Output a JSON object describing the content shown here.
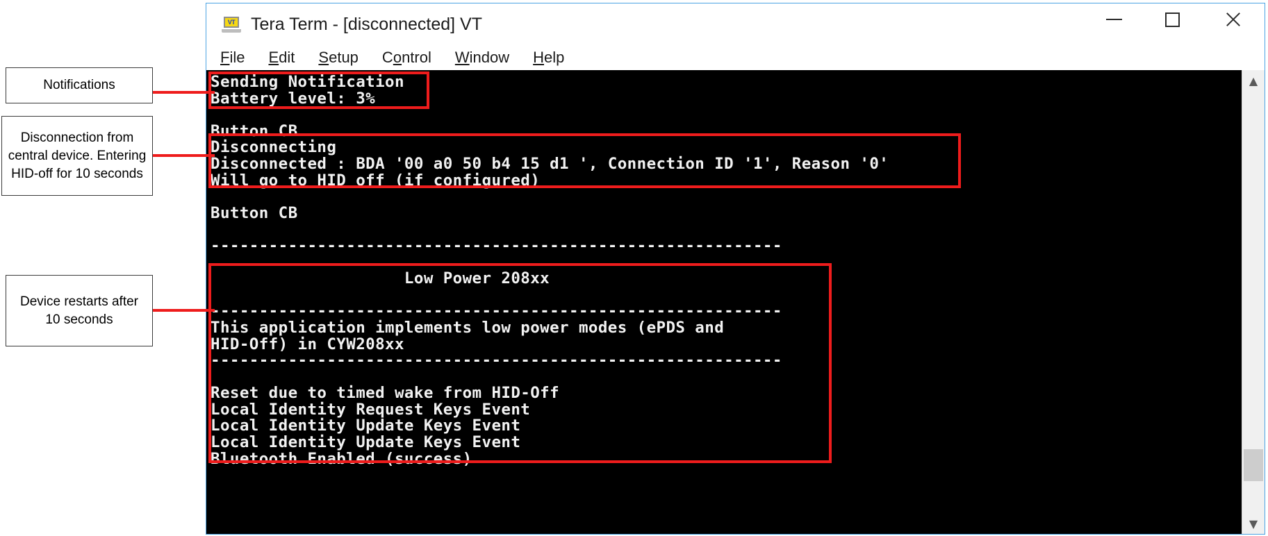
{
  "window": {
    "title": "Tera Term - [disconnected] VT",
    "icon": "teraterm-vt-icon",
    "icon_text": "VT",
    "controls": {
      "minimize": "minimize-icon",
      "maximize": "maximize-icon",
      "close": "close-icon"
    }
  },
  "menubar": {
    "items": [
      {
        "label": "File",
        "accel": "F"
      },
      {
        "label": "Edit",
        "accel": "E"
      },
      {
        "label": "Setup",
        "accel": "S"
      },
      {
        "label": "Control",
        "accel": "o"
      },
      {
        "label": "Window",
        "accel": "W"
      },
      {
        "label": "Help",
        "accel": "H"
      }
    ]
  },
  "terminal": {
    "lines": [
      "Sending Notification",
      "Battery level: 3%",
      "",
      "Button CB",
      "Disconnecting",
      "Disconnected : BDA '00 a0 50 b4 15 d1 ', Connection ID '1', Reason '0'",
      "Will go to HID off (if configured)",
      "",
      "Button CB",
      "",
      "-----------------------------------------------------------",
      "",
      "                    Low Power 208xx",
      "",
      "-----------------------------------------------------------",
      "This application implements low power modes (ePDS and",
      "HID-Off) in CYW208xx",
      "-----------------------------------------------------------",
      "",
      "Reset due to timed wake from HID-Off",
      "Local Identity Request Keys Event",
      "Local Identity Update Keys Event",
      "Local Identity Update Keys Event",
      "Bluetooth Enabled (success)"
    ]
  },
  "scrollbar": {
    "up_arrow": "chevron-up-icon",
    "down_arrow": "chevron-down-icon"
  },
  "annotations": {
    "notifications": "Notifications",
    "disconnection": "Disconnection from central device. Entering HID-off for 10 seconds",
    "restart": "Device restarts after 10 seconds"
  },
  "colors": {
    "highlight": "#ee1c1c",
    "window_border": "#4ba3e3",
    "terminal_bg": "#000000",
    "terminal_fg": "#f2f2f2"
  }
}
